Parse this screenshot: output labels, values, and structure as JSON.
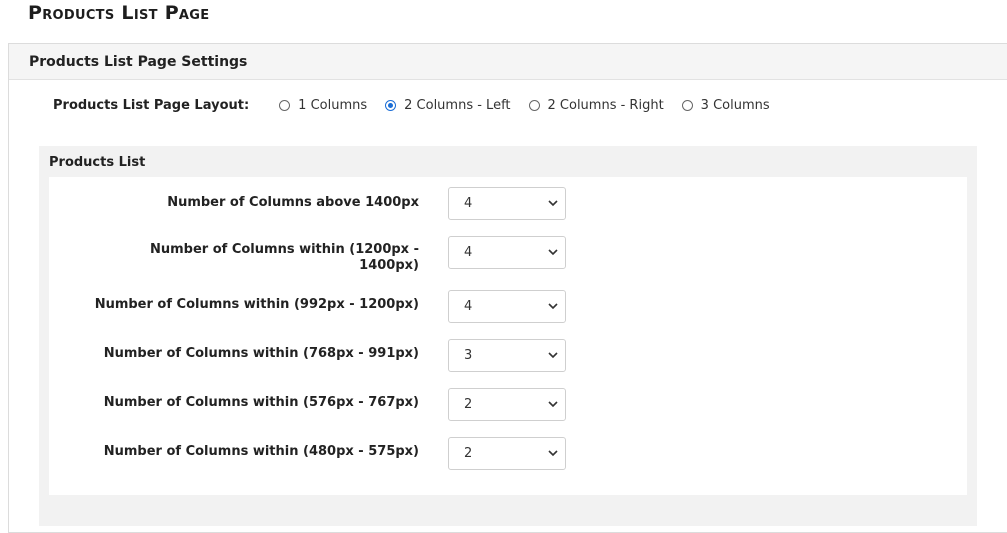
{
  "page": {
    "title": "Products List Page"
  },
  "panel": {
    "header": "Products List Page Settings"
  },
  "layout": {
    "label": "Products List Page Layout:",
    "options": [
      {
        "label": "1 Columns",
        "checked": false
      },
      {
        "label": "2 Columns - Left",
        "checked": true
      },
      {
        "label": "2 Columns - Right",
        "checked": false
      },
      {
        "label": "3 Columns",
        "checked": false
      }
    ]
  },
  "products_list": {
    "title": "Products List",
    "fields": [
      {
        "label": "Number of Columns above 1400px",
        "value": "4"
      },
      {
        "label": "Number of Columns within (1200px - 1400px)",
        "value": "4"
      },
      {
        "label": "Number of Columns within (992px - 1200px)",
        "value": "4"
      },
      {
        "label": "Number of Columns within (768px - 991px)",
        "value": "3"
      },
      {
        "label": "Number of Columns within (576px - 767px)",
        "value": "2"
      },
      {
        "label": "Number of Columns within (480px - 575px)",
        "value": "2"
      }
    ]
  },
  "colors": {
    "accent": "#1a6dd6",
    "panel_header_bg": "#f5f5f5",
    "group_bg": "#f2f2f2"
  }
}
